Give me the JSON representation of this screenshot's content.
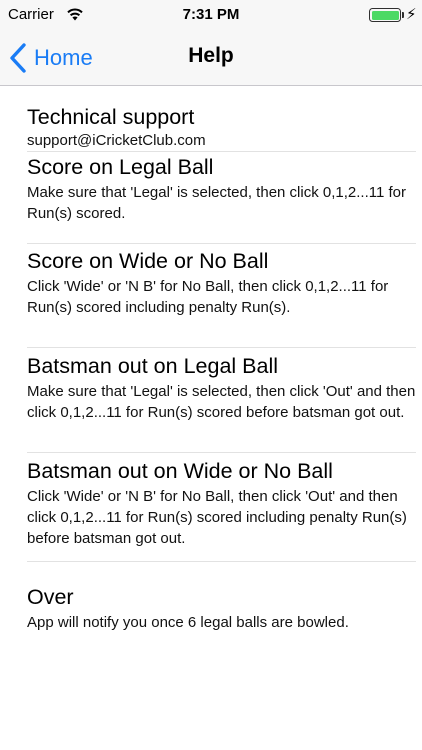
{
  "status": {
    "carrier": "Carrier",
    "time": "7:31 PM",
    "battery_level": 1.0,
    "battery_color": "#4cd964"
  },
  "nav": {
    "back_label": "Home",
    "title": "Help",
    "accent": "#1a7cf5"
  },
  "sections": [
    {
      "title": "Technical support",
      "body": "support@iCricketClub.com"
    },
    {
      "title": "Score on Legal Ball",
      "body": "Make sure that 'Legal' is selected, then click 0,1,2...11 for Run(s) scored."
    },
    {
      "title": "Score on Wide or No Ball",
      "body": "Click 'Wide' or 'N B' for No Ball, then click 0,1,2...11 for Run(s) scored including penalty Run(s)."
    },
    {
      "title": "Batsman out on Legal Ball",
      "body": "Make sure that 'Legal' is selected, then click 'Out' and then click 0,1,2...11 for Run(s) scored before batsman got out."
    },
    {
      "title": "Batsman out on Wide or No Ball",
      "body": "Click 'Wide' or 'N B' for No Ball, then click 'Out' and then click 0,1,2...11 for Run(s) scored including penalty Run(s) before batsman got out."
    },
    {
      "title": "Over",
      "body": "App will notify you once 6 legal balls are bowled."
    }
  ]
}
